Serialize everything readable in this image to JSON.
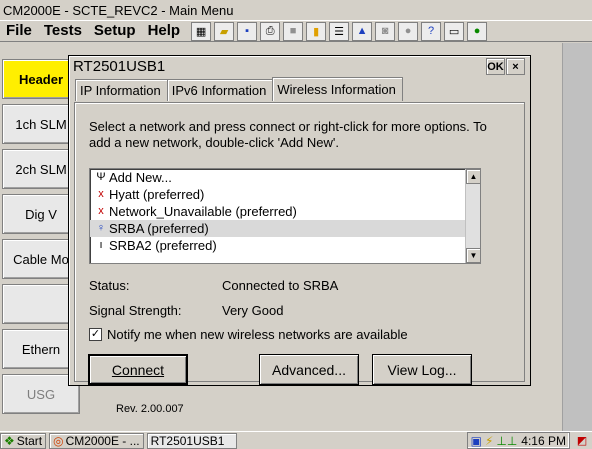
{
  "window": {
    "title": "CM2000E - SCTE_REVC2 - Main Menu"
  },
  "menubar": {
    "items": [
      "File",
      "Tests",
      "Setup",
      "Help"
    ]
  },
  "left_buttons": [
    {
      "label": "Header"
    },
    {
      "label": "1ch SLM"
    },
    {
      "label": "2ch SLM"
    },
    {
      "label": "Dig V"
    },
    {
      "label": "Cable Mo"
    },
    {
      "label": ""
    },
    {
      "label": "Ethern"
    },
    {
      "label": "USG"
    }
  ],
  "revision": "Rev. 2.00.007",
  "dialog": {
    "title": "RT2501USB1",
    "ok_label": "OK",
    "close_label": "×",
    "tabs": [
      "IP Information",
      "IPv6 Information",
      "Wireless Information"
    ],
    "instructions": "Select a network and press connect or right-click for more options.  To add a new network, double-click 'Add New'.",
    "networks": [
      {
        "icon": "antenna-icon",
        "glyph": "Ψ",
        "label": "Add New..."
      },
      {
        "icon": "no-signal-icon",
        "glyph": "x",
        "label": "Hyatt (preferred)"
      },
      {
        "icon": "no-signal-icon",
        "glyph": "x",
        "label": "Network_Unavailable (preferred)"
      },
      {
        "icon": "connected-icon",
        "glyph": "♀",
        "label": "SRBA (preferred)"
      },
      {
        "icon": "signal-icon",
        "glyph": "ı",
        "label": "SRBA2 (preferred)"
      }
    ],
    "status_label": "Status:",
    "status_value": "Connected to SRBA",
    "signal_label": "Signal Strength:",
    "signal_value": "Very Good",
    "notify_label": "Notify me when new wireless networks are available",
    "notify_checked": true,
    "buttons": {
      "connect": "Connect",
      "advanced": "Advanced...",
      "view_log": "View Log..."
    }
  },
  "taskbar": {
    "start_label": "Start",
    "tasks": [
      "CM2000E - ...",
      "RT2501USB1"
    ],
    "time": "4:16 PM"
  },
  "colors": {
    "active_button": "#ffef00",
    "window_bg": "#d4d0c8",
    "selected_row": "#d9d9d9"
  }
}
